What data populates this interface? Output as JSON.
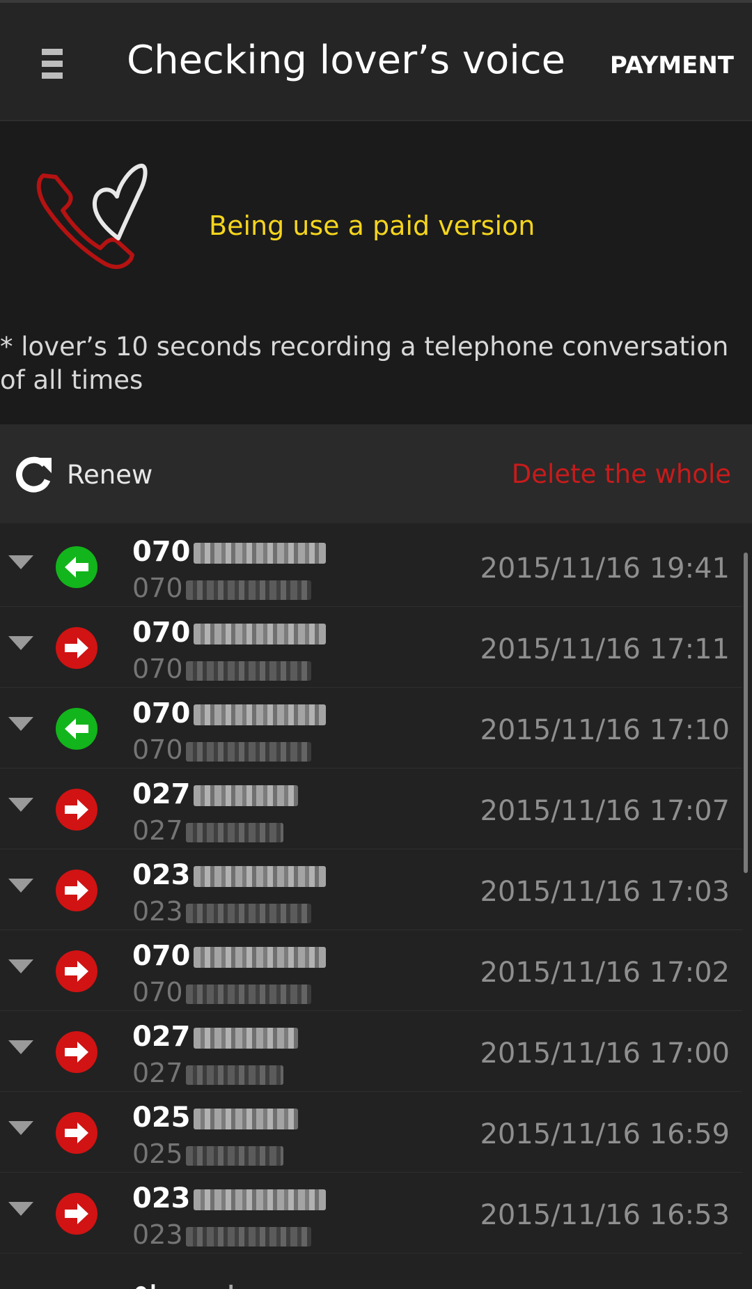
{
  "header": {
    "title": "Checking lover’s voice",
    "payment_label": "PAYMENT",
    "menu_icon": "hamburger-menu-icon"
  },
  "promo": {
    "logo_icon": "phone-heart-icon",
    "status_text": "Being use a paid version",
    "note": "* lover’s 10 seconds recording a telephone conversation of all times"
  },
  "toolbar": {
    "renew_label": "Renew",
    "renew_icon": "refresh-icon",
    "delete_label": "Delete the whole"
  },
  "calls": [
    {
      "prefix": "070",
      "direction": "incoming",
      "datetime": "2015/11/16 19:41"
    },
    {
      "prefix": "070",
      "direction": "outgoing",
      "datetime": "2015/11/16 17:11"
    },
    {
      "prefix": "070",
      "direction": "incoming",
      "datetime": "2015/11/16 17:10"
    },
    {
      "prefix": "027",
      "direction": "outgoing",
      "datetime": "2015/11/16 17:07"
    },
    {
      "prefix": "023",
      "direction": "outgoing",
      "datetime": "2015/11/16 17:03"
    },
    {
      "prefix": "070",
      "direction": "outgoing",
      "datetime": "2015/11/16 17:02"
    },
    {
      "prefix": "027",
      "direction": "outgoing",
      "datetime": "2015/11/16 17:00"
    },
    {
      "prefix": "025",
      "direction": "outgoing",
      "datetime": "2015/11/16 16:59"
    },
    {
      "prefix": "023",
      "direction": "outgoing",
      "datetime": "2015/11/16 16:53"
    }
  ],
  "colors": {
    "incoming": "#12b51b",
    "outgoing": "#d11313",
    "accent_yellow": "#f5d51d",
    "delete_red": "#c81b1b"
  }
}
